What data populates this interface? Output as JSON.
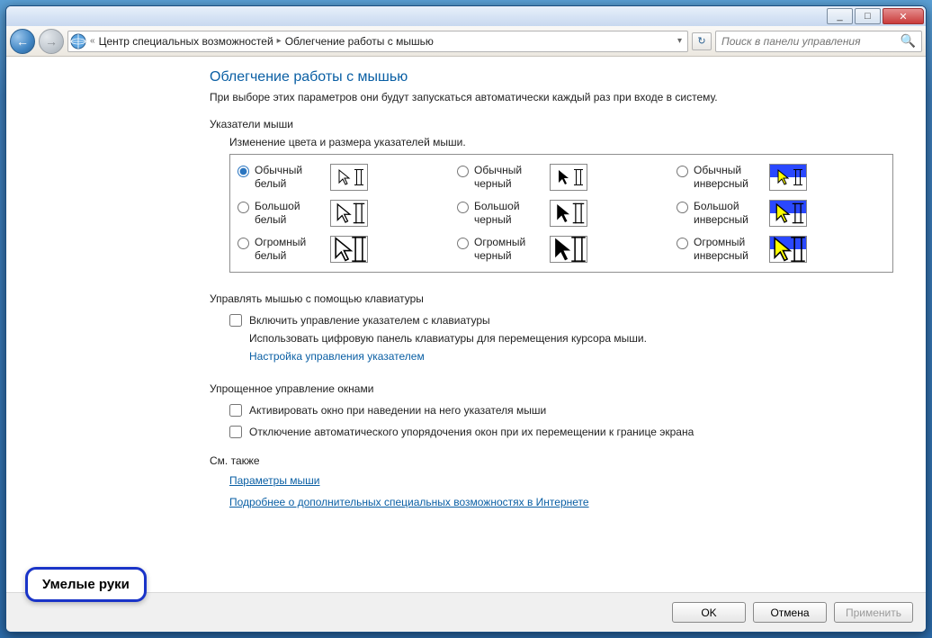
{
  "titlebar": {
    "min": "_",
    "max": "□",
    "close": "✕"
  },
  "nav": {
    "back_arrow": "←",
    "fwd_arrow": "→",
    "sep": "«",
    "crumb1": "Центр специальных возможностей",
    "crumbsep": "▸",
    "crumb2": "Облегчение работы с мышью",
    "dropdown": "▾",
    "refresh": "↻",
    "search_placeholder": "Поиск в панели управления",
    "search_icon": "🔍"
  },
  "main": {
    "title": "Облегчение работы с мышью",
    "subhead": "При выборе этих параметров они будут запускаться автоматически каждый раз при входе в систему.",
    "pointers_label": "Указатели мыши",
    "pointers_desc": "Изменение цвета и размера указателей мыши.",
    "options": [
      {
        "label": "Обычный белый",
        "checked": true
      },
      {
        "label": "Обычный черный",
        "checked": false
      },
      {
        "label": "Обычный инверсный",
        "checked": false
      },
      {
        "label": "Большой белый",
        "checked": false
      },
      {
        "label": "Большой черный",
        "checked": false
      },
      {
        "label": "Большой инверсный",
        "checked": false
      },
      {
        "label": "Огромный белый",
        "checked": false
      },
      {
        "label": "Огромный черный",
        "checked": false
      },
      {
        "label": "Огромный инверсный",
        "checked": false
      }
    ],
    "keyboard_section": "Управлять мышью с помощью клавиатуры",
    "keyboard_chk": "Включить управление указателем с клавиатуры",
    "keyboard_desc": "Использовать цифровую панель клавиатуры для перемещения курсора мыши.",
    "keyboard_link": "Настройка управления указателем",
    "window_section": "Упрощенное управление окнами",
    "window_chk1": "Активировать окно при наведении на него указателя мыши",
    "window_chk2": "Отключение автоматического упорядочения окон при их перемещении к границе экрана",
    "seealso": "См. также",
    "link1": "Параметры мыши",
    "link2": "Подробнее о дополнительных специальных возможностях в Интернете"
  },
  "buttons": {
    "ok": "OK",
    "cancel": "Отмена",
    "apply": "Применить"
  },
  "badge": "Умелые руки"
}
